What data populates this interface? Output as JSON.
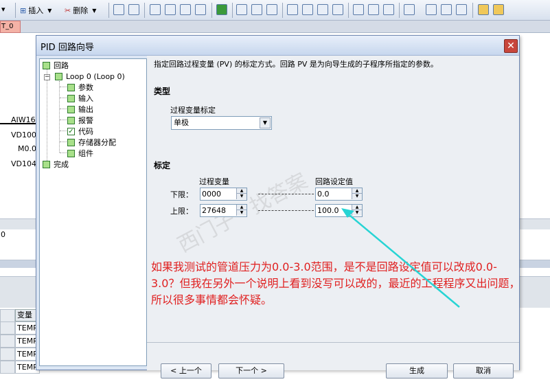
{
  "toolbar": {
    "insert_label": "插入",
    "delete_label": "删除"
  },
  "tab": {
    "label": "T_0"
  },
  "background": {
    "labels": [
      "AIW16",
      "VD100",
      "M0.0",
      "VD104"
    ],
    "value_cell": "0",
    "grid_header": "变量名",
    "grid_rows": [
      "TEMP",
      "TEMP",
      "TEMP",
      "TEMP"
    ]
  },
  "dialog": {
    "title": "PID 回路向导",
    "close_label": "✕",
    "tree": {
      "root": "回路",
      "loop": "Loop 0 (Loop 0)",
      "items": [
        "参数",
        "输入",
        "输出",
        "报警",
        "代码",
        "存储器分配",
        "组件"
      ],
      "finish": "完成"
    },
    "description": "指定回路过程变量 (PV) 的标定方式。回路 PV 是为向导生成的子程序所指定的参数。",
    "type_section": {
      "heading": "类型",
      "field_label": "过程变量标定",
      "selected": "单极"
    },
    "scale_section": {
      "heading": "标定",
      "col_pv": "过程变量",
      "col_sp": "回路设定值",
      "low_label": "下限：",
      "high_label": "上限：",
      "pv_low": "0000",
      "pv_high": "27648",
      "sp_low": "0.0",
      "sp_high": "100.0"
    },
    "annotation": "如果我测试的管道压力为0.0-3.0范围，是不是回路设定值可以改成0.0-3.0？但我在另外一个说明上看到没写可以改的，最近的工程程序又出问题，所以很多事情都会怀疑。",
    "buttons": {
      "prev": "< 上一个",
      "next": "下一个 >",
      "generate": "生成",
      "cancel": "取消"
    }
  }
}
